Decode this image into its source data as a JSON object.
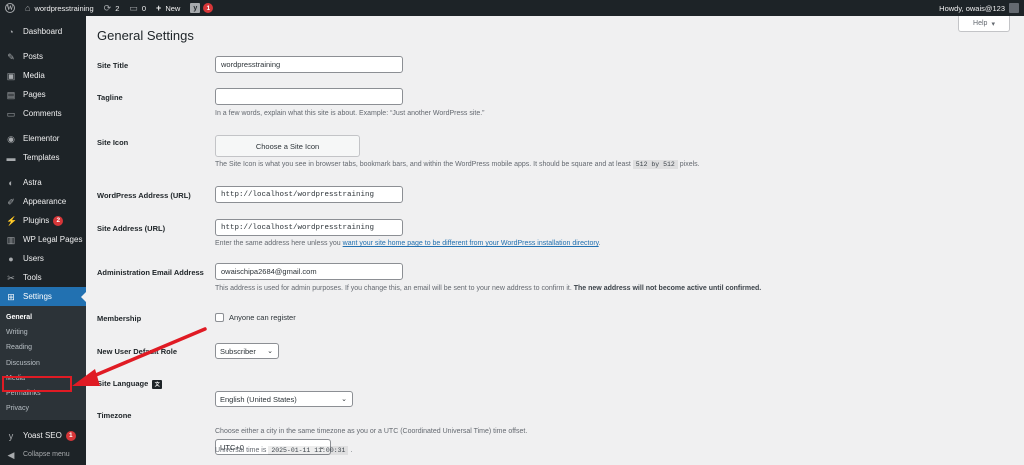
{
  "adminbar": {
    "site_name": "wordpresstraining",
    "updates_count": "2",
    "comments_count": "0",
    "new_label": "New",
    "yoast_count": "1",
    "howdy": "Howdy, owais@123"
  },
  "sidebar": {
    "items": [
      {
        "label": "Dashboard",
        "icon": "dashboard-icon"
      },
      {
        "label": "Posts",
        "icon": "pin-icon"
      },
      {
        "label": "Media",
        "icon": "media-icon"
      },
      {
        "label": "Pages",
        "icon": "pages-icon"
      },
      {
        "label": "Comments",
        "icon": "comments-icon"
      },
      {
        "label": "Elementor",
        "icon": "elementor-icon"
      },
      {
        "label": "Templates",
        "icon": "folder-icon"
      },
      {
        "label": "Astra",
        "icon": "astra-icon"
      },
      {
        "label": "Appearance",
        "icon": "paintbrush-icon"
      },
      {
        "label": "Plugins",
        "icon": "plugins-icon",
        "badge": "2"
      },
      {
        "label": "WP Legal Pages",
        "icon": "legal-icon"
      },
      {
        "label": "Users",
        "icon": "users-icon"
      },
      {
        "label": "Tools",
        "icon": "wrench-icon"
      },
      {
        "label": "Settings",
        "icon": "settings-icon"
      }
    ],
    "submenu": [
      "General",
      "Writing",
      "Reading",
      "Discussion",
      "Media",
      "Permalinks",
      "Privacy"
    ],
    "yoast": {
      "label": "Yoast SEO",
      "badge": "1"
    },
    "collapse": "Collapse menu"
  },
  "help": {
    "label": "Help",
    "chevron": "▾"
  },
  "page": {
    "title": "General Settings",
    "site_title": {
      "label": "Site Title",
      "value": "wordpresstraining"
    },
    "tagline": {
      "label": "Tagline",
      "value": "",
      "desc": "In a few words, explain what this site is about. Example: “Just another WordPress site.”"
    },
    "site_icon": {
      "label": "Site Icon",
      "button": "Choose a Site Icon",
      "desc_a": "The Site Icon is what you see in browser tabs, bookmark bars, and within the WordPress mobile apps. It should be square and at least",
      "size_a": "512",
      "by": "by",
      "size_b": "512",
      "desc_b": "pixels."
    },
    "wp_address": {
      "label": "WordPress Address (URL)",
      "value": "http://localhost/wordpresstraining"
    },
    "site_address": {
      "label": "Site Address (URL)",
      "value": "http://localhost/wordpresstraining",
      "desc_a": "Enter the same address here unless you",
      "link": "want your site home page to be different from your WordPress installation directory",
      "desc_b": "."
    },
    "admin_email": {
      "label": "Administration Email Address",
      "value": "owaischipa2684@gmail.com",
      "desc_a": "This address is used for admin purposes. If you change this, an email will be sent to your new address to confirm it.",
      "desc_b": "The new address will not become active until confirmed."
    },
    "membership": {
      "label": "Membership",
      "checkbox": "Anyone can register"
    },
    "default_role": {
      "label": "New User Default Role",
      "value": "Subscriber"
    },
    "language": {
      "label": "Site Language",
      "value": "English (United States)"
    },
    "timezone": {
      "label": "Timezone",
      "value": "UTC+0",
      "desc": "Choose either a city in the same timezone as you or a UTC (Coordinated Universal Time) time offset."
    },
    "universal_time": {
      "label": "Universal time is",
      "value": "2025-01-11 11:00:31",
      "suffix": "."
    }
  }
}
